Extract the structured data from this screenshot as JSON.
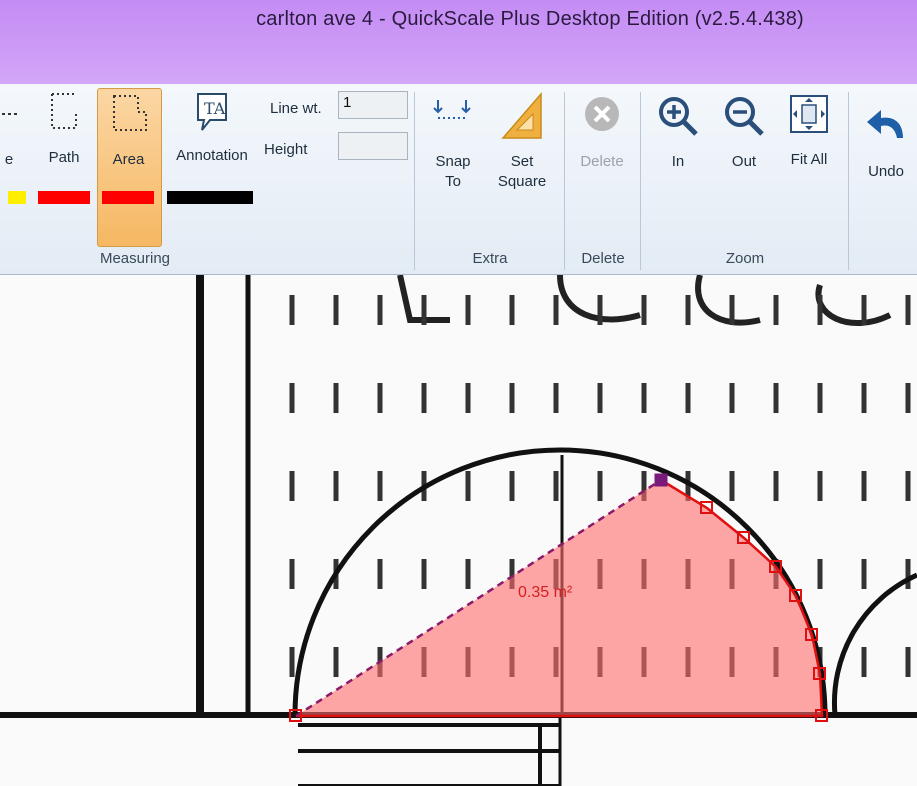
{
  "window": {
    "title": "carlton ave 4 - QuickScale Plus Desktop Edition (v2.5.4.438)"
  },
  "ribbon": {
    "measuring": {
      "group_label": "Measuring",
      "partial_label": "e",
      "path_label": "Path",
      "area_label": "Area",
      "annotation_label": "Annotation",
      "line_wt_label": "Line wt.",
      "line_wt_value": "1",
      "height_label": "Height",
      "height_value": ""
    },
    "extra": {
      "group_label": "Extra",
      "snap_label_1": "Snap",
      "snap_label_2": "To",
      "set_square_label_1": "Set",
      "set_square_label_2": "Square"
    },
    "delete": {
      "group_label": "Delete",
      "delete_label": "Delete"
    },
    "zoom": {
      "group_label": "Zoom",
      "in_label": "In",
      "out_label": "Out",
      "fit_all_label": "Fit All"
    },
    "undo_label": "Undo"
  },
  "canvas": {
    "area_measurement": "0.35 m²"
  },
  "colors": {
    "title_bar": "#c896f5",
    "active_button": "#f6c27a",
    "area_fill": "#ff6b6b",
    "area_outline": "#e01010",
    "dashed_line": "#8a1a6a",
    "swatch_yellow": "#ffee00",
    "swatch_red": "#ff0000",
    "swatch_black": "#000000"
  },
  "icons": [
    "path-icon",
    "area-icon",
    "annotation-icon",
    "snap-to-icon",
    "set-square-icon",
    "delete-icon",
    "zoom-in-icon",
    "zoom-out-icon",
    "fit-all-icon",
    "undo-icon"
  ]
}
